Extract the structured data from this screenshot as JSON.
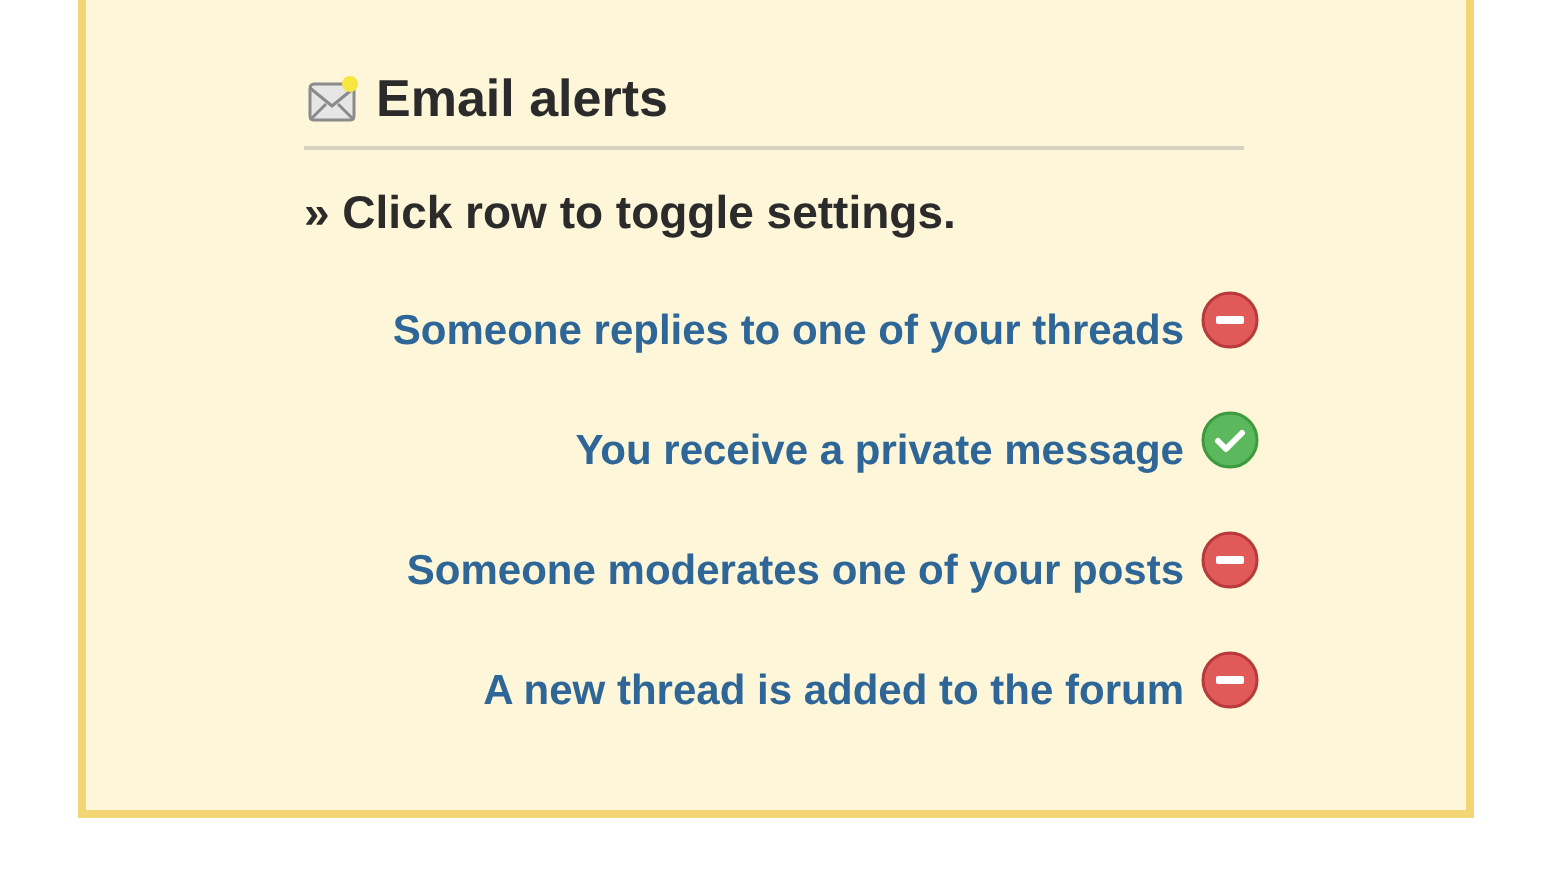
{
  "title": "Email alerts",
  "instruction": "» Click row to toggle settings.",
  "alerts": [
    {
      "label": "Someone replies to one of your threads",
      "on": false
    },
    {
      "label": "You receive a private message",
      "on": true
    },
    {
      "label": "Someone moderates one of your posts",
      "on": false
    },
    {
      "label": "A new thread is added to the forum",
      "on": false
    }
  ]
}
